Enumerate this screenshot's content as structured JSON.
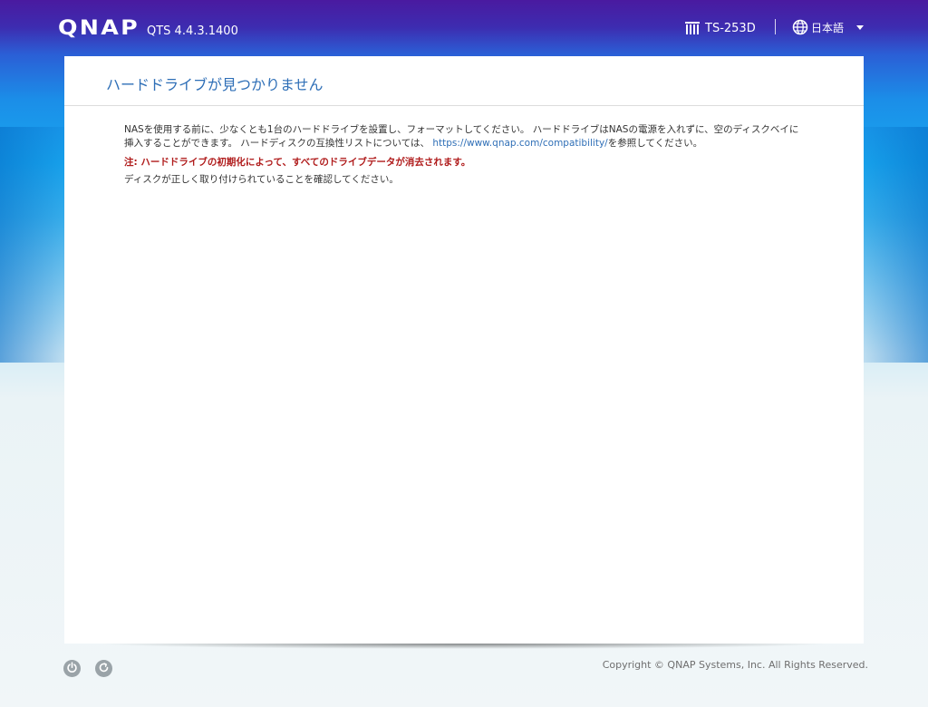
{
  "header": {
    "logo": "QNAP",
    "version": "QTS 4.4.3.1400",
    "model": "TS-253D",
    "language": "日本語"
  },
  "panel": {
    "title": "ハードドライブが見つかりません",
    "message_part1": "NASを使用する前に、少なくとも1台のハードドライブを設置し、フォーマットしてください。 ハードドライブはNASの電源を入れずに、空のディスクベイに挿入することができます。 ハードディスクの互換性リストについては、 ",
    "compat_link": "https://www.qnap.com/compatibility/",
    "message_part2": "を参照してください。",
    "warning": "注: ハードドライブの初期化によって、すべてのドライブデータが消去されます。",
    "check_note": "ディスクが正しく取り付けられていることを確認してください。"
  },
  "footer": {
    "copyright": "Copyright © QNAP Systems, Inc. All Rights Reserved.",
    "icons": [
      "power-icon",
      "restart-icon"
    ]
  },
  "colors": {
    "title_blue": "#2f6fb7",
    "warning_red": "#b01c1c",
    "link_blue": "#2f6fb7"
  }
}
